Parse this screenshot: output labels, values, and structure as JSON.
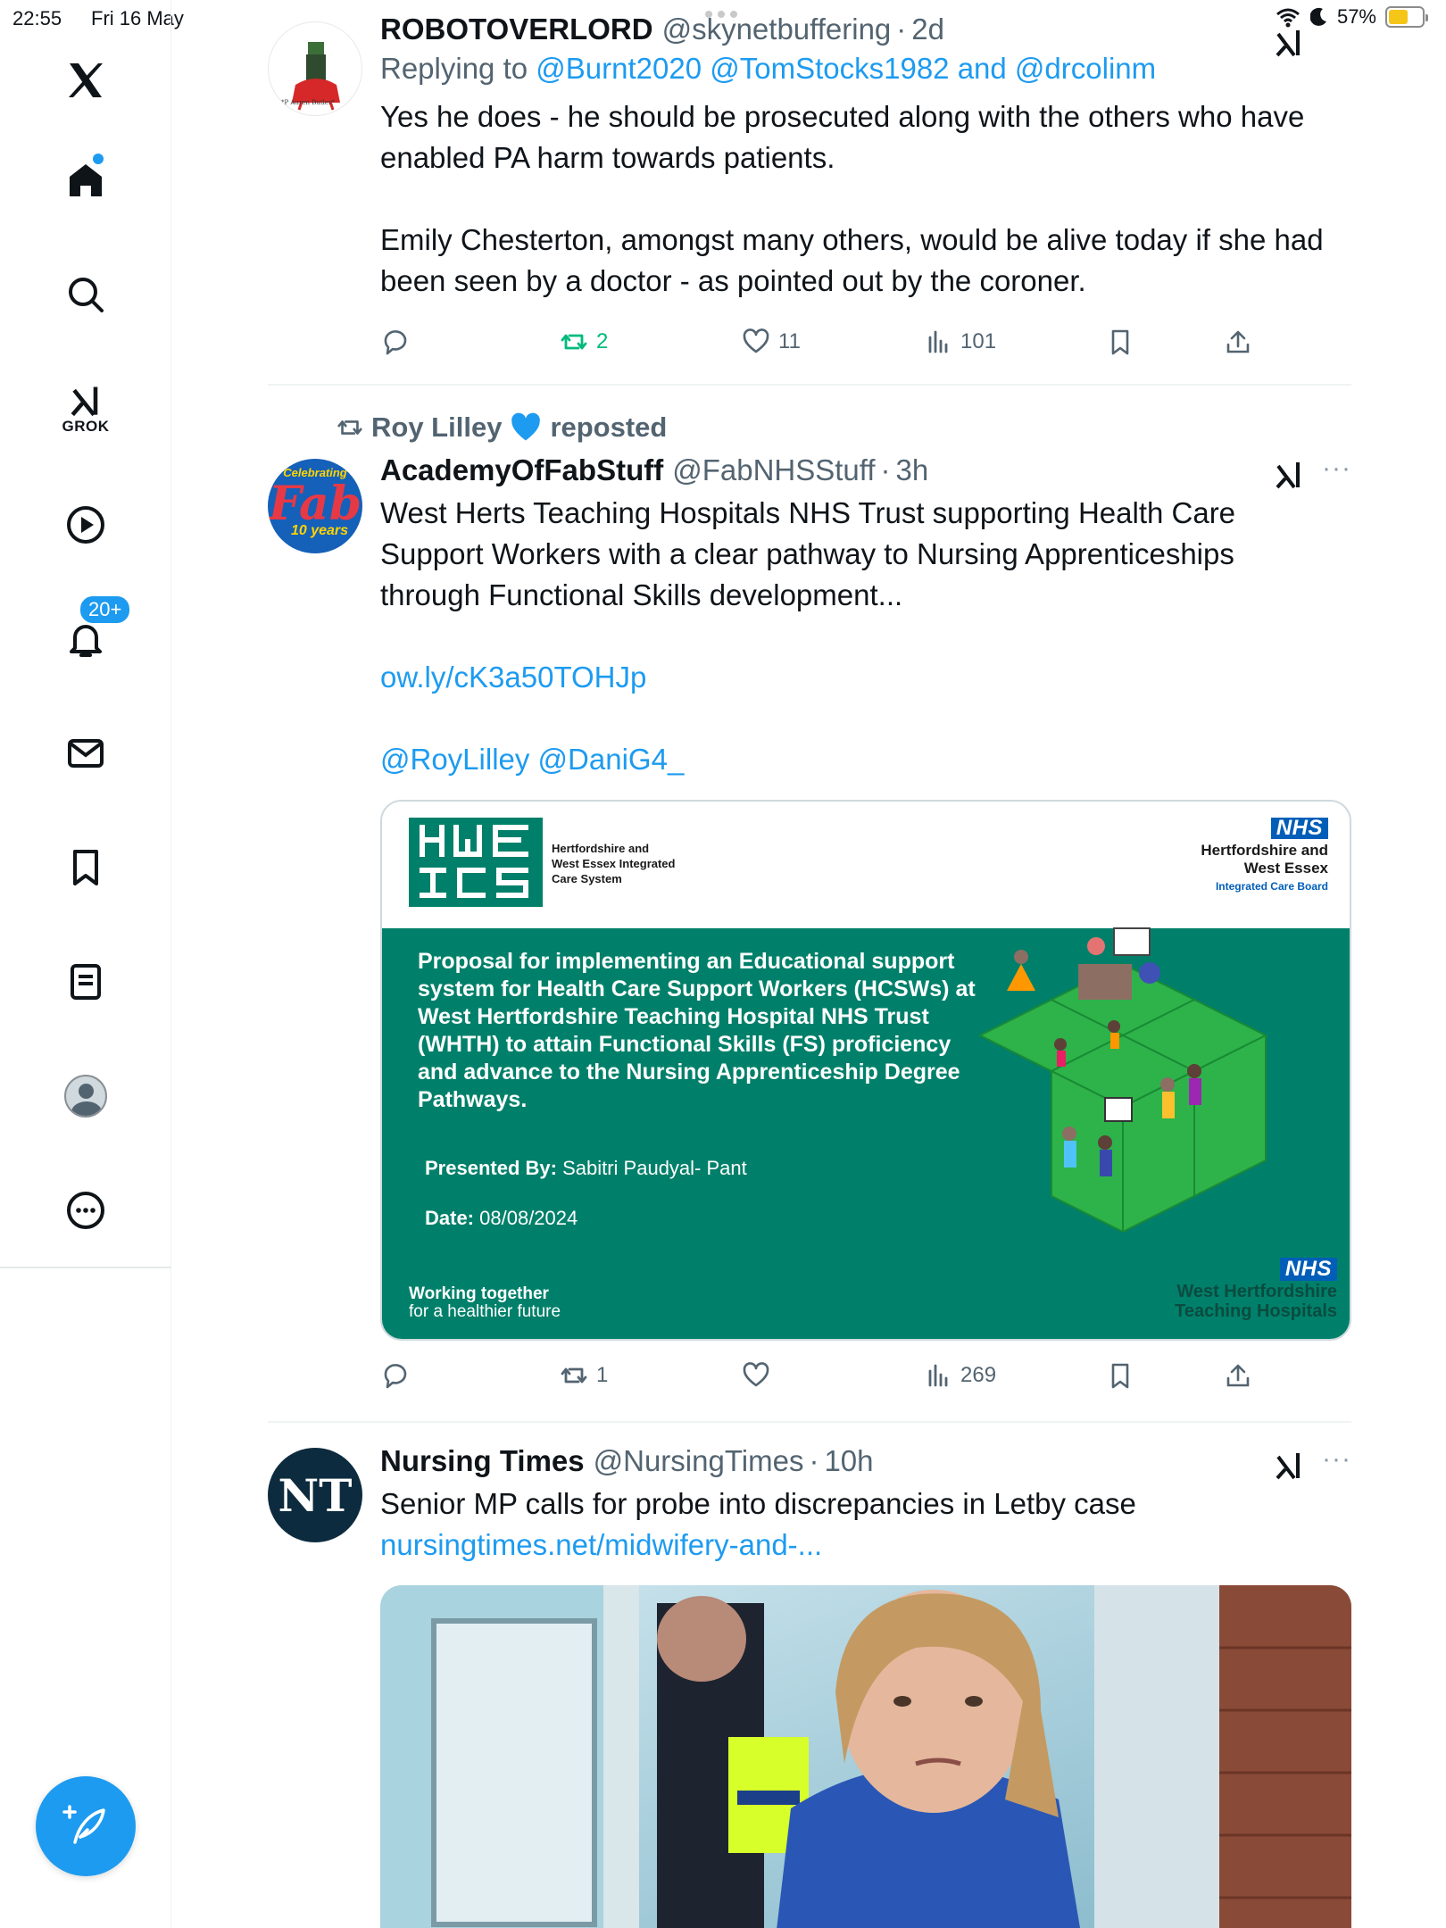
{
  "status_bar": {
    "time": "22:55",
    "date": "Fri 16 May",
    "battery": "57%",
    "battery_level": 0.57
  },
  "sidebar": {
    "items": [
      {
        "name": "x-logo",
        "icon": "x-logo-icon"
      },
      {
        "name": "home",
        "icon": "home-icon",
        "has_dot": true
      },
      {
        "name": "search",
        "icon": "search-icon"
      },
      {
        "name": "grok",
        "icon": "grok-icon",
        "label": "GROK"
      },
      {
        "name": "video",
        "icon": "play-icon"
      },
      {
        "name": "notifications",
        "icon": "bell-icon",
        "badge": "20+"
      },
      {
        "name": "messages",
        "icon": "mail-icon"
      },
      {
        "name": "bookmarks",
        "icon": "bookmark-icon"
      },
      {
        "name": "lists",
        "icon": "list-icon"
      },
      {
        "name": "profile",
        "icon": "avatar-icon"
      },
      {
        "name": "more",
        "icon": "more-icon"
      }
    ],
    "compose_icon": "compose-icon"
  },
  "tweets": [
    {
      "name": "ROBOTOVERLORD",
      "handle": "@skynetbuffering",
      "time": "2d",
      "replying_prefix": "Replying to",
      "replying_to": "@Burnt2020 @TomStocks1982 and @drcolinm",
      "text": "Yes he does - he should be prosecuted along with the others who have enabled PA harm towards patients.\n\nEmily Chesterton, amongst many others, would be alive today if she had been seen by a doctor - as pointed out by the coroner.",
      "avatar_text": "*P Auren Butler*",
      "stats": {
        "replies": "",
        "reposts": "2",
        "likes": "11",
        "views": "101"
      }
    },
    {
      "reposted_by": "Roy Lilley",
      "reposted_label": "reposted",
      "name": "AcademyOfFabStuff",
      "handle": "@FabNHSStuff",
      "time": "3h",
      "text": "West Herts Teaching Hospitals NHS Trust supporting Health Care Support Workers with a clear pathway to Nursing Apprenticeships through Functional Skills development...",
      "link": "ow.ly/cK3a50TOHJp",
      "mentions": "@RoyLilley @DaniG4_",
      "avatar_line1": "Celebrating",
      "avatar_line2": "Fab",
      "avatar_line3": "10 years",
      "slide": {
        "org_name": "Hertfordshire and\nWest Essex Integrated\nCare System",
        "nhs_label": "NHS",
        "board_line1": "Hertfordshire and",
        "board_line2": "West Essex",
        "board_line3": "Integrated Care Board",
        "title": "Proposal for implementing an Educational support system for Health Care Support Workers (HCSWs) at West Hertfordshire Teaching Hospital NHS Trust (WHTH) to attain Functional Skills (FS) proficiency and advance to the Nursing Apprenticeship Degree Pathways.",
        "presented_label": "Presented By:",
        "presenter": "Sabitri Paudyal- Pant",
        "date_label": "Date:",
        "date": "08/08/2024",
        "footer_line1": "Working together",
        "footer_line2": "for a healthier future",
        "trust_line1": "West Hertfordshire",
        "trust_line2": "Teaching Hospitals"
      },
      "stats": {
        "replies": "",
        "reposts": "1",
        "likes": "",
        "views": "269"
      }
    },
    {
      "name": "Nursing Times",
      "handle": "@NursingTimes",
      "time": "10h",
      "avatar_text": "NT",
      "text": "Senior MP calls for probe into discrepancies in Letby case",
      "link": "nursingtimes.net/midwifery-and-..."
    }
  ],
  "colors": {
    "accent": "#1d9bf0",
    "repost_green": "#00ba7c",
    "muted": "#536471",
    "slide_green": "#00806a",
    "nhs_blue": "#005eb8"
  }
}
